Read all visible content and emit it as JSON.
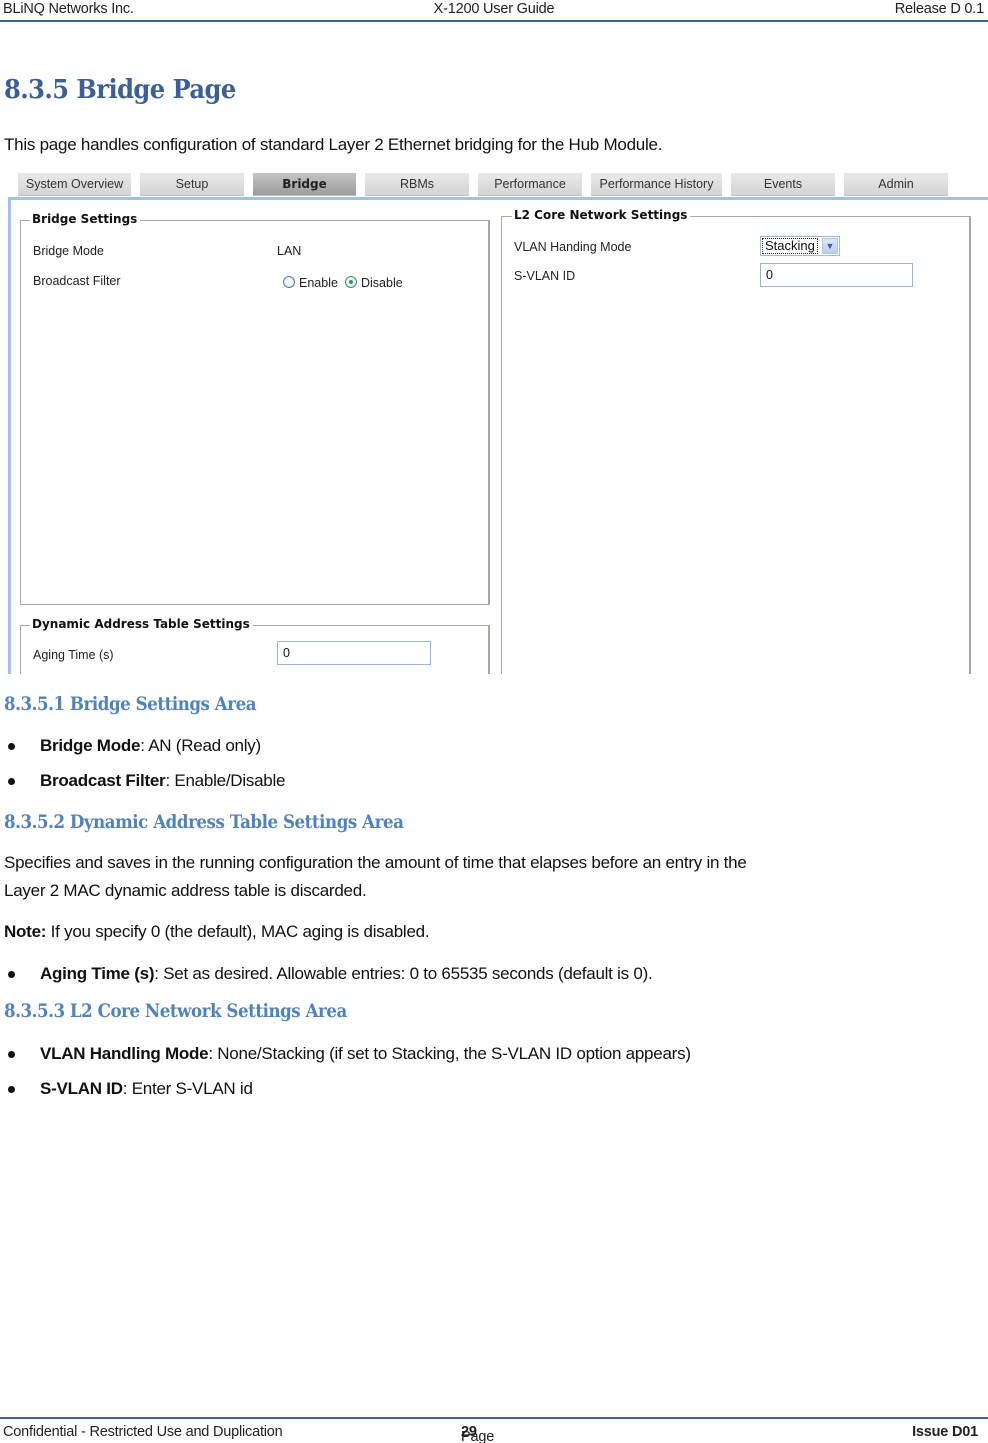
{
  "header": {
    "company": "BLiNQ Networks Inc.",
    "doc_title": "X-1200 User Guide",
    "release": "Release D 0.1"
  },
  "section": {
    "title": "8.3.5 Bridge Page",
    "intro": "This page handles configuration of standard Layer 2 Ethernet bridging for the Hub Module."
  },
  "screenshot": {
    "tabs": [
      {
        "label": "System Overview",
        "active": false
      },
      {
        "label": "Setup",
        "active": false
      },
      {
        "label": "Bridge",
        "active": true
      },
      {
        "label": "RBMs",
        "active": false
      },
      {
        "label": "Performance",
        "active": false
      },
      {
        "label": "Performance History",
        "active": false
      },
      {
        "label": "Events",
        "active": false
      },
      {
        "label": "Admin",
        "active": false
      }
    ],
    "bridge_settings": {
      "legend": "Bridge Settings",
      "bridge_mode_label": "Bridge Mode",
      "bridge_mode_value": "LAN",
      "broadcast_filter_label": "Broadcast Filter",
      "broadcast_options": [
        {
          "label": "Enable",
          "checked": false
        },
        {
          "label": "Disable",
          "checked": true
        }
      ]
    },
    "dynamic_address": {
      "legend": "Dynamic Address Table Settings",
      "aging_time_label": "Aging Time (s)",
      "aging_time_value": "0"
    },
    "l2_core": {
      "legend": "L2 Core Network Settings",
      "vlan_mode_label": "VLAN Handing Mode",
      "vlan_mode_value": "Stacking",
      "svlan_label": "S-VLAN ID",
      "svlan_value": "0"
    }
  },
  "subsections": {
    "bridge_settings_area": {
      "title": "8.3.5.1 Bridge Settings Area",
      "bullets": [
        {
          "term": "Bridge Mode",
          "desc": ": AN (Read only)"
        },
        {
          "term": "Broadcast Filter",
          "desc": ": Enable/Disable"
        }
      ]
    },
    "dynamic_area": {
      "title": "8.3.5.2 Dynamic Address Table Settings Area",
      "para1_line1": "Specifies and saves in the running configuration the amount of time that elapses before an entry in the",
      "para1_line2": "Layer 2 MAC dynamic address table is discarded.",
      "note_label": "Note:",
      "note_text": " If you specify 0 (the default), MAC aging is disabled.",
      "bullets": [
        {
          "term": "Aging Time (s)",
          "desc": ": Set as desired. Allowable entries: 0 to 65535 seconds (default is 0)."
        }
      ]
    },
    "l2_area": {
      "title": "8.3.5.3 L2 Core Network Settings Area",
      "bullets": [
        {
          "term": "VLAN Handling Mode",
          "desc": ": None/Stacking (if set to Stacking, the S-VLAN ID option appears)"
        },
        {
          "term": "S-VLAN ID",
          "desc": ": Enter S-VLAN id"
        }
      ]
    }
  },
  "footer": {
    "confidential": "Confidential - Restricted Use and Duplication",
    "page_prefix": "Page ",
    "page_number": "29",
    "issue": "Issue D01"
  }
}
